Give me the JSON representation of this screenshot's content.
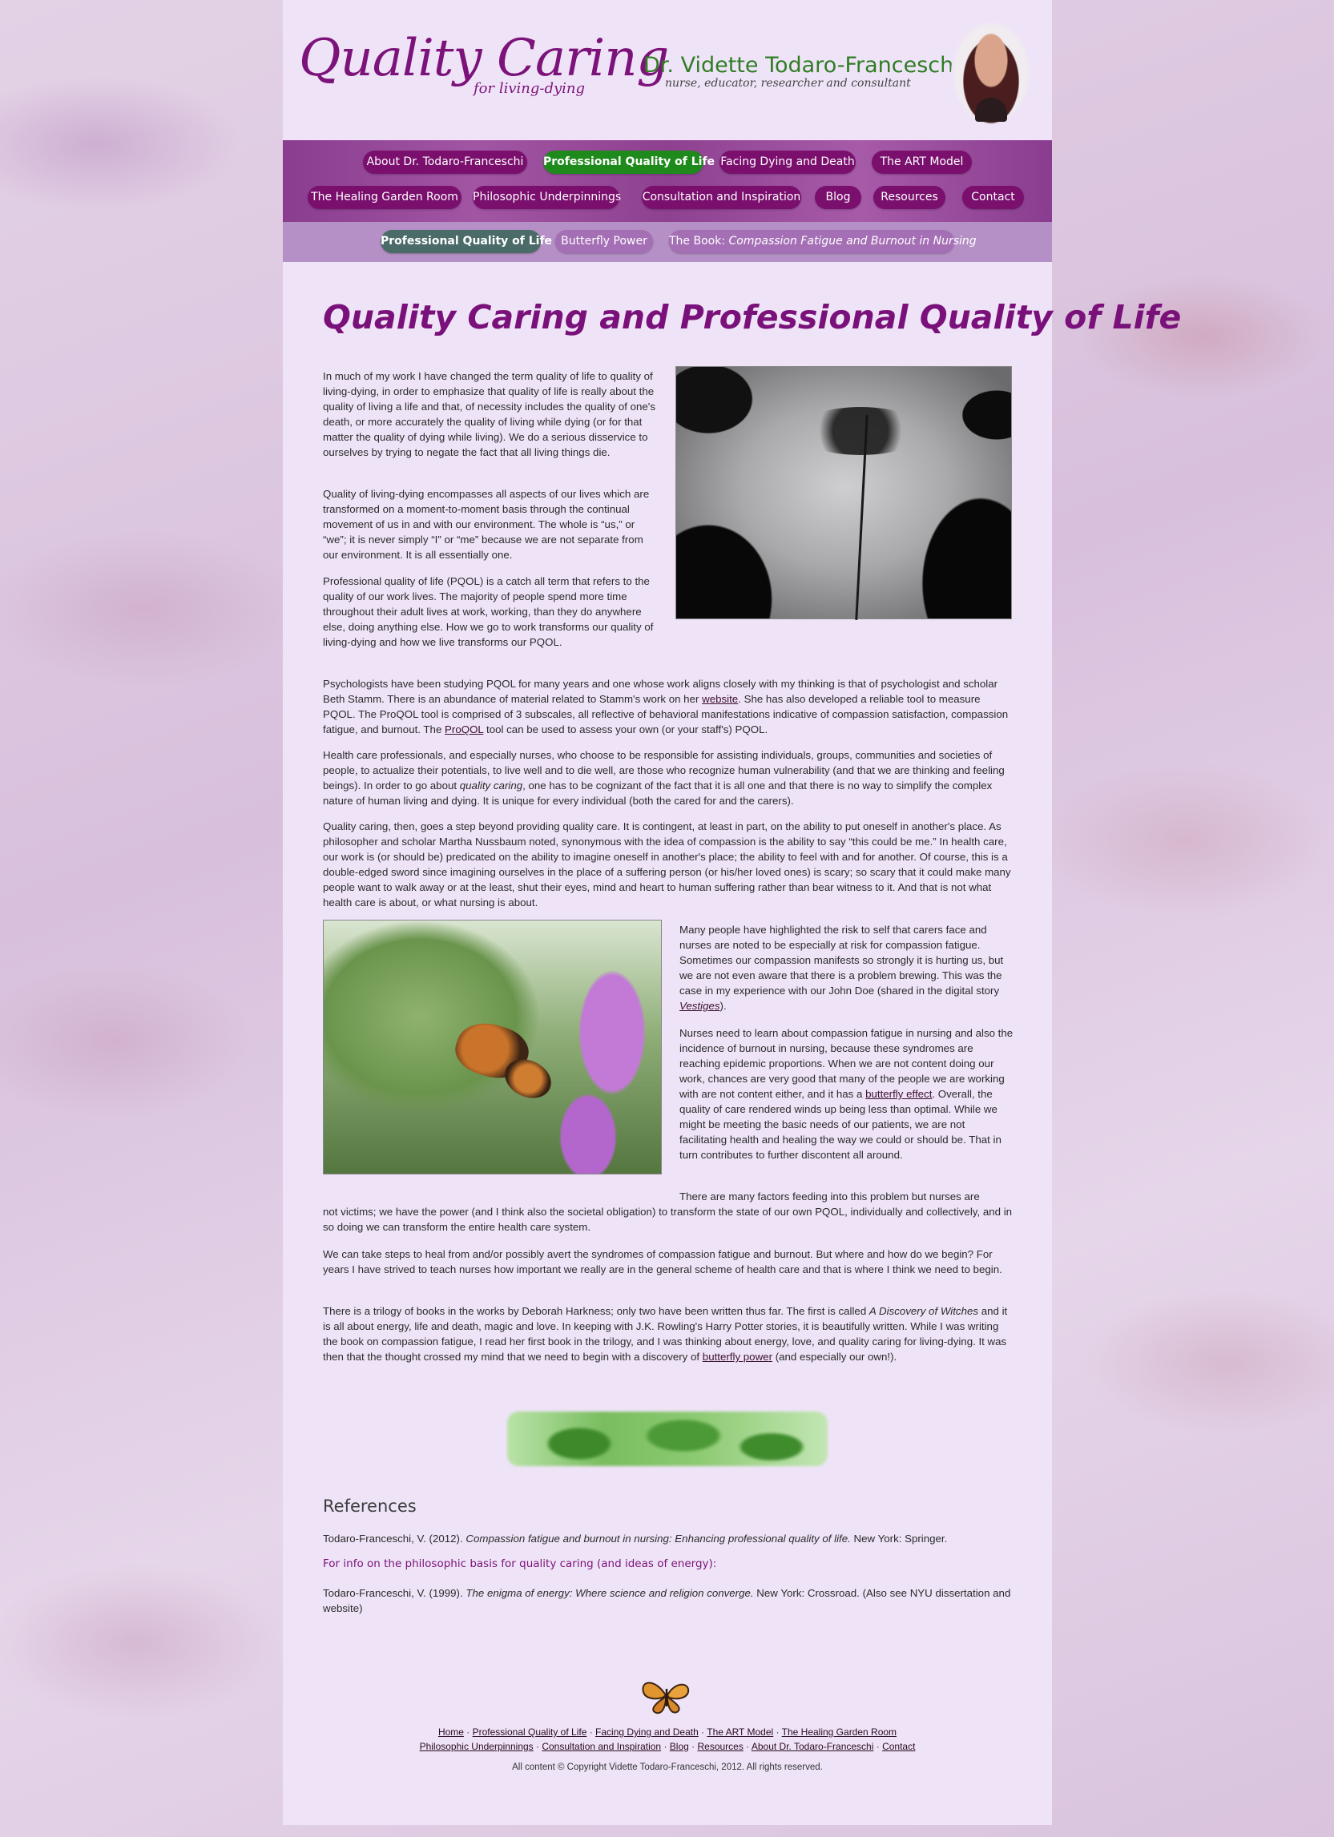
{
  "header": {
    "logo_main": "Quality Caring",
    "logo_sub": "for living-dying",
    "doctor_name": "Dr. Vidette Todaro-Franceschi",
    "doctor_tagline": "nurse, educator, researcher and consultant"
  },
  "nav": {
    "primary_row1": [
      "About Dr. Todaro-Franceschi",
      "Professional Quality of Life",
      "Facing Dying and Death",
      "The ART Model"
    ],
    "primary_row2": [
      "The Healing Garden Room",
      "Philosophic Underpinnings",
      "Consultation and Inspiration",
      "Blog",
      "Resources",
      "Contact"
    ],
    "secondary": {
      "item1": "Professional Quality of Life",
      "item2": "Butterfly Power",
      "item3_prefix": "The Book: ",
      "item3_title": "Compassion Fatigue and Burnout in Nursing"
    }
  },
  "main": {
    "title": "Quality Caring and Professional Quality of Life",
    "p1": "In much of my work I have changed the term quality of life to quality of living-dying, in order to emphasize that quality of life is really about the quality of living a life and that, of necessity includes the quality of one's death, or more accurately the quality of living while dying (or for that matter the quality of dying while living). We do a serious disservice to ourselves by trying to negate the fact that all living things die.",
    "p2": "Quality of living-dying encompasses all aspects of our lives which are transformed on a moment-to-moment basis through the continual movement of us in and with our environment. The whole is “us,” or “we”; it is never simply “I” or “me” because we are not separate from our environment. It is all essentially one.",
    "p3": "Professional quality of life (PQOL) is a catch all term that refers to the quality of our work lives. The majority of people spend more time throughout their adult lives at work, working, than they do anywhere else, doing anything else. How we go to work transforms our quality of living-dying and how we live transforms our PQOL.",
    "p4_a": "Psychologists have been studying PQOL for many years and one whose work aligns closely with my thinking is that of psychologist and scholar Beth Stamm. There is an abundance of material related to Stamm's work on her ",
    "p4_link1": "website",
    "p4_b": ". She has also developed a reliable tool to measure PQOL. The ProQOL tool is comprised of 3 subscales, all reflective of behavioral manifestations indicative of compassion satisfaction, compassion fatigue, and burnout. The ",
    "p4_link2": "ProQOL",
    "p4_c": " tool can be used to assess your own (or your staff's) PQOL.",
    "p5_a": "Health care professionals, and especially nurses, who choose to be responsible for assisting individuals, groups, communities and societies of people, to actualize their potentials, to live well and to die well, are those who recognize human vulnerability (and that we are thinking and feeling beings). In order to go about ",
    "p5_em": "quality caring",
    "p5_b": ", one has to be cognizant of the fact that it is all one and that there is no way to simplify the complex nature of human living and dying. It is unique for every individual (both the cared for and the carers).",
    "p6": "Quality caring, then, goes a step beyond providing quality care. It is contingent, at least in part, on the ability to put oneself in another's place. As philosopher and scholar Martha Nussbaum noted, synonymous with the idea of compassion is the ability to say “this could be me.” In health care, our work is (or should be) predicated on the ability to imagine oneself in another's place; the ability to feel with and for another. Of course, this is a double-edged sword since imagining ourselves in the place of a suffering person (or his/her loved ones) is scary; so scary that it could make many people want to walk away or at the least, shut their eyes, mind and heart to human suffering rather than bear witness to it. And that is not what health care is about, or what nursing is about.",
    "p7_a": "Many people have highlighted the risk to self that carers face and nurses are noted to be especially at risk for compassion fatigue. Sometimes our compassion manifests so strongly it is hurting us, but we are not even aware that there is a problem brewing. This was the case in my experience with our John Doe (shared in the digital story ",
    "p7_link": "Vestiges",
    "p7_b": ").",
    "p8_a": "Nurses need to learn about compassion fatigue in nursing and also the incidence of burnout in nursing, because these syndromes are reaching epidemic proportions. When we are not content doing our work, chances are very good that many of the people we are working with are not content either, and it has a ",
    "p8_link": "butterfly effect",
    "p8_b": ". Overall, the quality of care rendered winds up being less than optimal. While we might be meeting the basic needs of our patients, we are not facilitating health and healing the way we could or should be. That in turn contributes to further discontent all around.",
    "p9_first": "There are many factors feeding into this problem but nurses are",
    "p9_rest": "not victims; we have the power (and I think also the societal obligation) to transform the state of our own PQOL, individually and collectively, and in so doing we can transform the entire health care system.",
    "p10": "We can take steps to heal from and/or possibly avert the syndromes of compassion fatigue and burnout. But where and how do we begin? For years I have strived to teach nurses how important we really are in the general scheme of health care and that is where I think we need to begin.",
    "p11_a": "There is a trilogy of books in the works by Deborah Harkness; only two have been written thus far. The first is called ",
    "p11_em": "A Discovery of Witches",
    "p11_b": " and it is all about energy, life and death, magic and love. In keeping with J.K. Rowling's Harry Potter stories, it is beautifully written. While I was writing the book on compassion fatigue, I read her first book in the trilogy, and I was thinking about energy, love, and quality caring for living-dying. It was then that the thought crossed my mind that we need to begin with a discovery of ",
    "p11_link": "butterfly power",
    "p11_c": " (and especially our own!)."
  },
  "references": {
    "title": "References",
    "ref1_a": "Todaro-Franceschi, V. (2012). ",
    "ref1_em": "Compassion fatigue and burnout in nursing: Enhancing professional quality of life.",
    "ref1_b": " New York: Springer.",
    "note": "For info on the philosophic basis for quality caring (and ideas of energy):",
    "ref2_a": "Todaro-Franceschi, V. (1999). ",
    "ref2_em": "The enigma of energy: Where science and religion converge.",
    "ref2_b": " New York: Crossroad. (Also see NYU dissertation and website)"
  },
  "footer": {
    "row1": [
      "Home",
      "Professional Quality of Life",
      "Facing Dying and Death",
      "The ART Model",
      "The Healing Garden Room"
    ],
    "row2": [
      "Philosophic Underpinnings",
      "Consultation and Inspiration",
      "Blog",
      "Resources",
      "About Dr. Todaro-Franceschi",
      "Contact"
    ],
    "separator": " · ",
    "copyright": "All content © Copyright Vidette Todaro-Franceschi, 2012. All rights reserved."
  },
  "colors": {
    "brand_purple": "#7c137a",
    "active_green": "#1e8a1b",
    "name_green": "#2f7d24",
    "sub_active_teal": "#4b6b69",
    "page_bg": "#efe4f7"
  },
  "icons": [
    "butterfly-icon"
  ]
}
